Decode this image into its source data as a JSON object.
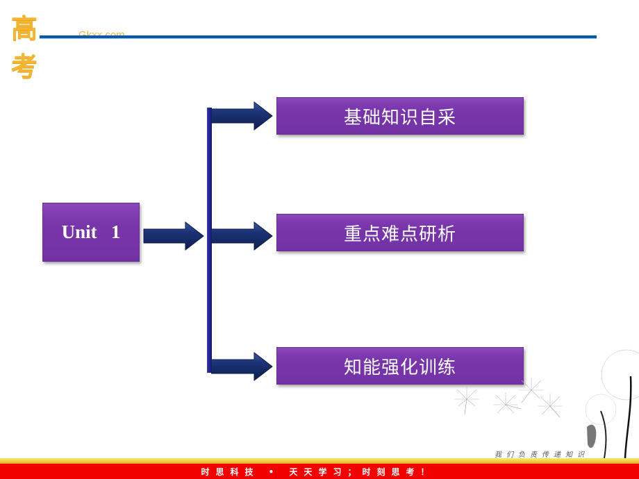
{
  "header": {
    "logo_cn": "高考",
    "logo_en": "Gkxx.com"
  },
  "diagram": {
    "root": "Unit   1",
    "branches": [
      {
        "label": "基础知识自采"
      },
      {
        "label": "重点难点研析"
      },
      {
        "label": "知能强化训练"
      }
    ]
  },
  "footer": {
    "slogan": "我们负责传递知识",
    "banner": "时思科技 • 天天学习；时刻思考！"
  },
  "colors": {
    "box_purple": "#7a36ac",
    "arrow_navy": "#1a2f6e",
    "header_line": "#0b59a8",
    "footer_red": "#f20000",
    "logo_gold": "#f2b630"
  }
}
